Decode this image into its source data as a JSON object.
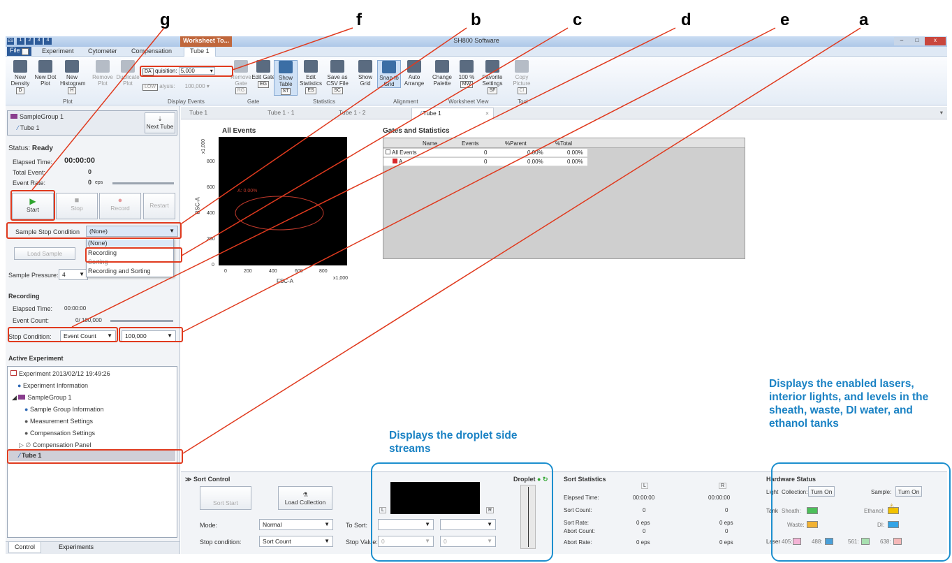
{
  "callouts": [
    "g",
    "f",
    "b",
    "c",
    "d",
    "e",
    "a"
  ],
  "window": {
    "title": "SH800 Software",
    "badge": "ES",
    "quick_access": [
      "1",
      "2",
      "3",
      "4"
    ],
    "controls": [
      "–",
      "□",
      "x"
    ]
  },
  "ribbon_tabs": {
    "file": "File",
    "file_key": "F",
    "experiment": "Experiment",
    "cytometer": "Cytometer",
    "compensation": "Compensation",
    "context_group": "Worksheet To...",
    "active": "Tube 1"
  },
  "ribbon": {
    "new_density": "New Density",
    "new_density_key": "D",
    "new_dot_plot": "New Dot Plot",
    "new_histogram": "New Histogram",
    "new_histogram_key": "H",
    "remove_plot": "Remove Plot",
    "duplicate_plot": "Duplicate Plot",
    "plot_group": "Plot",
    "da_prefix": "DA",
    "acquisition_label": "quisition:",
    "acquisition_value": "5,000",
    "low_prefix": "LOW",
    "analysis_label": "alysis:",
    "analysis_value": "100,000",
    "display_events_group": "Display Events",
    "remove_gate": "Remove Gate",
    "remove_gate_key": "RG",
    "edit_gate": "Edit Gate",
    "edit_gate_key": "EG",
    "gate_group": "Gate",
    "show_table": "Show Table",
    "show_table_key": "ST",
    "edit_statistics": "Edit Statistics",
    "edit_statistics_key": "ES",
    "save_csv": "Save as CSV File",
    "save_csv_key": "SC",
    "statistics_group": "Statistics",
    "show_grid": "Show Grid",
    "snap_to_grid": "Snap to Grid",
    "auto_arrange": "Auto Arrange",
    "alignment_group": "Alignment",
    "change_palette": "Change Palette",
    "zoom_100": "100 %",
    "zoom_key": "MW",
    "favorite_settings": "Favorite Settings",
    "favorite_key": "SF",
    "worksheet_view_group": "Worksheet View",
    "copy_picture": "Copy Picture",
    "copy_key": "CI",
    "tool_group": "Tool"
  },
  "left_panel": {
    "sample_group": "SampleGroup 1",
    "tube": "Tube 1",
    "next_tube": "Next Tube",
    "status_label": "Status:",
    "status_value": "Ready",
    "elapsed_label": "Elapsed Time:",
    "elapsed_value": "00:00:00",
    "total_event_label": "Total Event:",
    "total_event_value": "0",
    "event_rate_label": "Event Rate:",
    "event_rate_value": "0",
    "event_rate_unit": "eps",
    "start": "Start",
    "stop": "Stop",
    "record": "Record",
    "restart": "Restart",
    "sample_stop_label": "Sample Stop Condition",
    "sample_stop_value": "(None)",
    "dropdown_options": [
      "(None)",
      "Recording",
      "Sorting",
      "Recording and Sorting"
    ],
    "load_sample": "Load Sample",
    "pressure_label": "Sample Pressure:",
    "pressure_value": "4",
    "recording_title": "Recording",
    "rec_elapsed_label": "Elapsed Time:",
    "rec_elapsed_value": "00:00:00",
    "rec_count_label": "Event Count:",
    "rec_count_value": "0/ 100,000",
    "stop_condition_label": "Stop Condition:",
    "stop_condition_value": "Event Count",
    "stop_count_value": "100,000",
    "active_experiment_title": "Active Experiment",
    "tree": [
      "Experiment 2013/02/12 19:49:26",
      "Experiment Information",
      "SampleGroup 1",
      "Sample Group Information",
      "Measurement Settings",
      "Compensation Settings",
      "Compensation Panel",
      "Tube 1"
    ],
    "bottom_tabs": [
      "Control",
      "Experiments"
    ]
  },
  "doc_tabs": [
    "Tube 1",
    "Tube 1 - 1",
    "Tube 1 - 2",
    "Tube 1"
  ],
  "plot": {
    "title": "All Events",
    "ylabel": "BSC-A",
    "xlabel": "FSC-A",
    "y_ticks": [
      "x1,000",
      "800",
      "600",
      "400",
      "200",
      "0"
    ],
    "x_ticks": [
      "0",
      "200",
      "400",
      "600",
      "800",
      "x1,000"
    ],
    "gate_label": "A: 0.00%"
  },
  "stats": {
    "title": "Gates and Statistics",
    "headers": [
      "Name",
      "Events",
      "%Parent",
      "%Total"
    ],
    "rows": [
      {
        "name": "All Events",
        "events": "0",
        "parent": "0.00%",
        "total": "0.00%"
      },
      {
        "name": "A",
        "events": "0",
        "parent": "0.00%",
        "total": "0.00%"
      }
    ]
  },
  "sort_control": {
    "title": "Sort Control",
    "sort_start": "Sort Start",
    "load_collection": "Load Collection",
    "mode_label": "Mode:",
    "mode_value": "Normal",
    "to_sort_label": "To Sort:",
    "stop_condition_label": "Stop condition:",
    "stop_condition_value": "Sort Count",
    "stop_value_label": "Stop Value:",
    "stop_value_l": "0",
    "stop_value_r": "0",
    "droplet": "Droplet",
    "side_l": "L",
    "side_r": "R"
  },
  "sort_statistics": {
    "title": "Sort Statistics",
    "col_l": "L",
    "col_r": "R",
    "rows": [
      {
        "label": "Elapsed Time:",
        "l": "00:00:00",
        "r": "00:00:00"
      },
      {
        "label": "Sort Count:",
        "l": "0",
        "r": "0"
      },
      {
        "label": "Sort Rate:",
        "l": "0 eps",
        "r": "0 eps"
      },
      {
        "label": "Abort Count:",
        "l": "0",
        "r": "0"
      },
      {
        "label": "Abort Rate:",
        "l": "0 eps",
        "r": "0 eps"
      }
    ]
  },
  "hardware": {
    "title": "Hardware Status",
    "light_label": "Light",
    "collection_label": "Collection:",
    "collection_btn": "Turn On",
    "sample_label": "Sample:",
    "sample_btn": "Turn On",
    "tank_label": "Tank",
    "sheath_label": "Sheath:",
    "ethanol_label": "Ethanol:",
    "waste_label": "Waste:",
    "di_label": "DI:",
    "laser_label": "Laser",
    "l405": "405:",
    "l488": "488:",
    "l561": "561:",
    "l638": "638:",
    "colors": {
      "sheath": "#4cbf5a",
      "ethanol": "#f2c200",
      "waste": "#f2b233",
      "di": "#33a4e6",
      "l405": "#f4b4d6",
      "l488": "#4aa0d9",
      "l561": "#a8e0b0",
      "l638": "#f5b8b8"
    }
  },
  "annotations": {
    "droplet": "Displays the droplet side streams",
    "hardware": "Displays the enabled lasers, interior lights, and levels in the sheath, waste, DI water, and ethanol tanks"
  }
}
